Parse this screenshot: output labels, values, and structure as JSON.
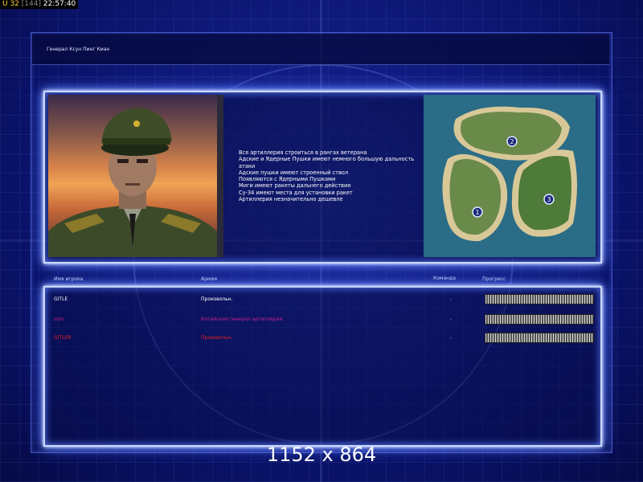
{
  "status_bar": {
    "u": "U 32",
    "bracket": "[144]",
    "time": "22:57:40"
  },
  "header": {
    "general_name": "Генерал Ксун Пинг Киан"
  },
  "general_description": [
    "Вся артиллерия строиться в рангах ветерана",
    "Адские и Ядерные Пушки имеют немного большую дальность",
    "атаки",
    "Адские пушки имеют строенный ствол",
    "Появляются с Ядерными Пушками",
    "Миги имеют ракеты дальнего действия",
    "Су-34 имеют места для установки ракет",
    "Артиллерия незначительно дешевле"
  ],
  "map": {
    "start_positions": [
      "1",
      "2",
      "3"
    ]
  },
  "columns": {
    "player": "Имя игрока",
    "army": "Армия",
    "team": "Команда",
    "progress": "Прогресс"
  },
  "players": [
    {
      "name": "GITLE",
      "army": "Произвольн.",
      "team": "-",
      "color": "#ffffff",
      "progress": 1.0
    },
    {
      "name": "ssm",
      "army": "Китайский генерал артиллерии",
      "team": "-",
      "color": "#c8208a",
      "progress": 1.0
    },
    {
      "name": "GITLER",
      "army": "Произвольн.",
      "team": "-",
      "color": "#e8201e",
      "progress": 1.0
    }
  ],
  "overlay": {
    "resolution": "1152 x 864"
  }
}
